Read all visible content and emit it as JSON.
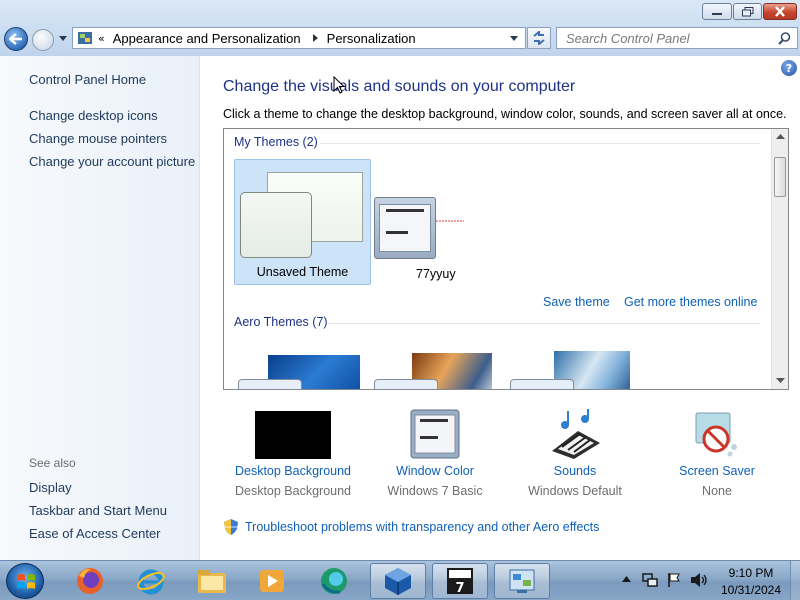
{
  "window": {
    "caption_buttons": {
      "minimize": "minimize",
      "maximize": "maximize",
      "close": "close"
    }
  },
  "nav": {
    "breadcrumb_prefix": "«",
    "breadcrumb": [
      "Appearance and Personalization",
      "Personalization"
    ],
    "search_placeholder": "Search Control Panel"
  },
  "sidebar": {
    "home": "Control Panel Home",
    "tasks": [
      "Change desktop icons",
      "Change mouse pointers",
      "Change your account picture"
    ],
    "see_also_heading": "See also",
    "see_also": [
      "Display",
      "Taskbar and Start Menu",
      "Ease of Access Center"
    ]
  },
  "main": {
    "help": "?",
    "title": "Change the visuals and sounds on your computer",
    "description": "Click a theme to change the desktop background, window color, sounds, and screen saver all at once.",
    "my_themes_header": "My Themes (2)",
    "themes": [
      {
        "name": "Unsaved Theme",
        "selected": true
      },
      {
        "name": "77yyuy",
        "selected": false
      }
    ],
    "save_theme": "Save theme",
    "get_more": "Get more themes online",
    "aero_header": "Aero Themes (7)"
  },
  "options": [
    {
      "label": "Desktop Background",
      "value": "Desktop Background",
      "icon": "black-background-icon"
    },
    {
      "label": "Window Color",
      "value": "Windows 7 Basic",
      "icon": "window-color-icon"
    },
    {
      "label": "Sounds",
      "value": "Windows Default",
      "icon": "sounds-icon"
    },
    {
      "label": "Screen Saver",
      "value": "None",
      "icon": "screen-saver-icon"
    }
  ],
  "troubleshoot": "Troubleshoot problems with transparency and other Aero effects",
  "taskbar": {
    "time": "9:10 PM",
    "date": "10/31/2024",
    "apps": [
      "firefox",
      "internet-explorer",
      "file-explorer",
      "media-player",
      "edge",
      "virtualbox",
      "7-zip",
      "control-panel"
    ]
  },
  "colors": {
    "link": "#0e60b8",
    "heading": "#1e3287",
    "selection": "#cde3f7"
  }
}
